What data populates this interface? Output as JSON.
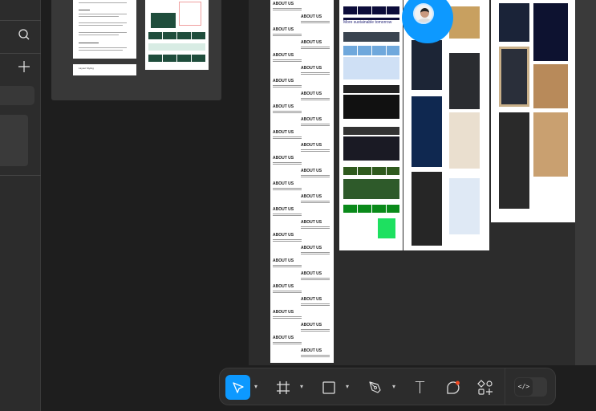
{
  "left_panel": {
    "icons": [
      "search-icon",
      "plus-icon"
    ]
  },
  "canvas": {
    "doc_label_lines": [
      "Layout Styling"
    ],
    "about_column": {
      "heading": "ABOUT US",
      "count": 28
    },
    "banner_text": "More sustainable tomorrow",
    "avatar_color": "#0d99ff"
  },
  "toolbar": {
    "tools": [
      {
        "name": "move",
        "icon": "cursor-icon",
        "selected": true,
        "has_menu": true
      },
      {
        "name": "frame",
        "icon": "frame-icon",
        "has_menu": true
      },
      {
        "name": "rectangle",
        "icon": "rectangle-icon",
        "has_menu": true
      },
      {
        "name": "pen",
        "icon": "pen-icon",
        "has_menu": true
      },
      {
        "name": "text",
        "icon": "text-icon",
        "glyph": "T"
      },
      {
        "name": "comment",
        "icon": "comment-icon",
        "badge_color": "#f24822"
      },
      {
        "name": "actions",
        "icon": "shapes-plus-icon"
      }
    ],
    "dev_mode_glyph": "</>",
    "accent": "#0d99ff"
  }
}
